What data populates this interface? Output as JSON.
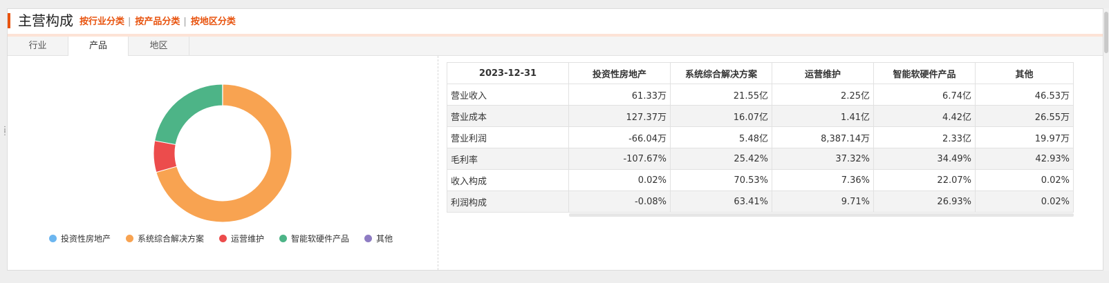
{
  "header": {
    "title": "主营构成",
    "links": [
      "按行业分类",
      "按产品分类",
      "按地区分类"
    ],
    "separator": "|"
  },
  "tabs": [
    {
      "label": "行业",
      "active": false
    },
    {
      "label": "产品",
      "active": true
    },
    {
      "label": "地区",
      "active": false
    }
  ],
  "chart_data": {
    "type": "pie",
    "style": "donut",
    "categories": [
      "投资性房地产",
      "系统综合解决方案",
      "运营维护",
      "智能软硬件产品",
      "其他"
    ],
    "values": [
      0.02,
      70.53,
      7.36,
      22.07,
      0.02
    ],
    "colors": [
      "#6cb6f0",
      "#f8a351",
      "#ec4c4c",
      "#4db487",
      "#8e7cc3"
    ],
    "legend_position": "bottom"
  },
  "table": {
    "columns": [
      "2023-12-31",
      "投资性房地产",
      "系统综合解决方案",
      "运营维护",
      "智能软硬件产品",
      "其他"
    ],
    "rows": [
      [
        "营业收入",
        "61.33万",
        "21.55亿",
        "2.25亿",
        "6.74亿",
        "46.53万"
      ],
      [
        "营业成本",
        "127.37万",
        "16.07亿",
        "1.41亿",
        "4.42亿",
        "26.55万"
      ],
      [
        "营业利润",
        "-66.04万",
        "5.48亿",
        "8,387.14万",
        "2.33亿",
        "19.97万"
      ],
      [
        "毛利率",
        "-107.67%",
        "25.42%",
        "37.32%",
        "34.49%",
        "42.93%"
      ],
      [
        "收入构成",
        "0.02%",
        "70.53%",
        "7.36%",
        "22.07%",
        "0.02%"
      ],
      [
        "利润构成",
        "-0.08%",
        "63.41%",
        "9.71%",
        "26.93%",
        "0.02%"
      ]
    ]
  },
  "colors": {
    "accent": "#e8530e",
    "header_underline": "#fde3d6"
  }
}
